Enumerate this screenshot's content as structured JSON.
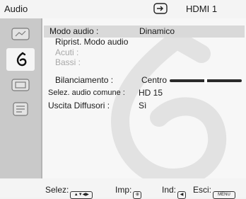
{
  "header": {
    "title": "Audio",
    "source_icon": "input-source-icon",
    "source_label": "HDMI 1"
  },
  "sidebar": {
    "items": [
      {
        "icon": "picture-settings-icon"
      },
      {
        "icon": "audio-note-icon",
        "active": true
      },
      {
        "icon": "screen-settings-icon"
      },
      {
        "icon": "setup-settings-icon"
      }
    ]
  },
  "menu": {
    "mode": {
      "label": "Modo audio :",
      "value": "Dinamico"
    },
    "reset": {
      "label": "Riprist. Modo audio"
    },
    "treble": {
      "label": "Acuti :"
    },
    "bass": {
      "label": "Bassi :"
    },
    "balance": {
      "label": "Bilanciamento :",
      "value": "Centro",
      "position": 0.5
    },
    "common_audio": {
      "label": "Selez. audio comune :",
      "value": "HD 15"
    },
    "speaker_out": {
      "label": "Uscita Diffusori :",
      "value": "Sì"
    }
  },
  "help": {
    "select": "Selez:",
    "set": "Imp:",
    "back": "Ind:",
    "exit": "Esci:",
    "menu_key": "MENU"
  },
  "colors": {
    "selected_row": "#d9d9d9",
    "sidebar": "#c9c9c9",
    "disabled_text": "#a8a8a8"
  }
}
